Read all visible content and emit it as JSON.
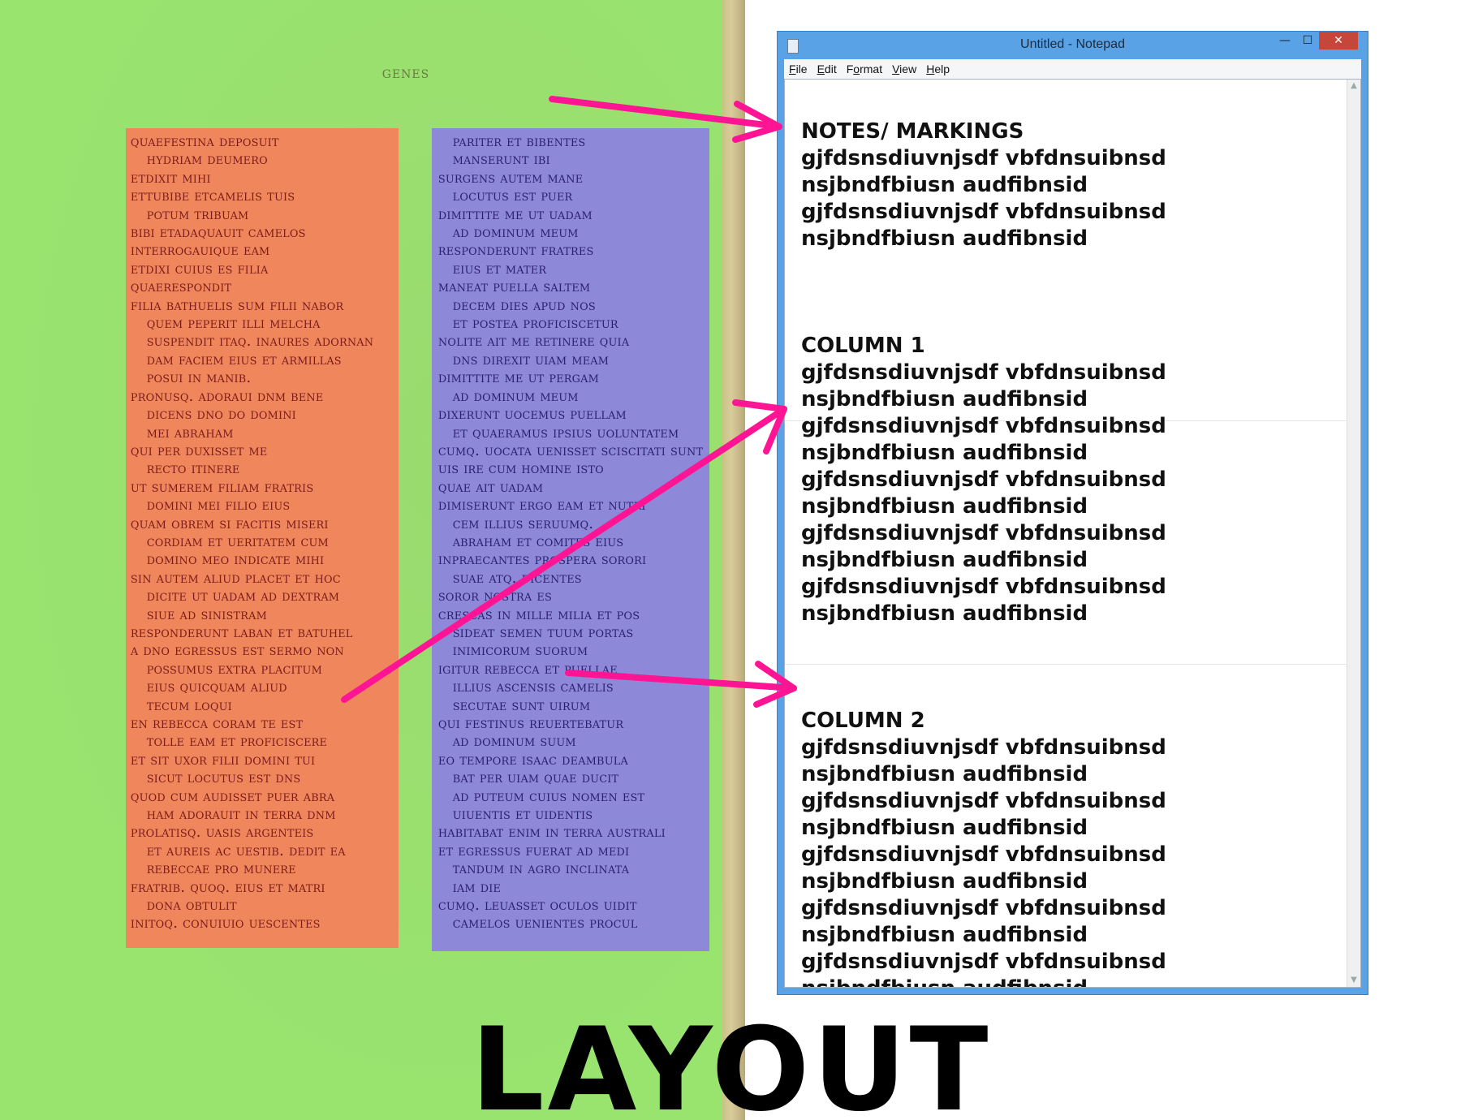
{
  "colors": {
    "page_background": "#98e46f",
    "column_1_highlight": "#f0875c",
    "column_2_highlight": "#8d88d8",
    "arrow": "#ff1493",
    "notepad_frame": "#5aa2e6",
    "close_button": "#c7463a"
  },
  "manuscript": {
    "running_head": "GENES",
    "column_1": [
      "quaefestina deposuit",
      "hydriam deumero",
      "etdixit mihi",
      "ettubibe etcamelis tuis",
      "potum tribuam",
      "bibi etadaquauit camelos",
      "interrogauique eam",
      "etdixi cuius es filia",
      "quaerespondit",
      "filia bathuelis sum filii nabor",
      "quem peperit illi melcha",
      "suspendit itaq. inaures adornan",
      "dam faciem eius et armillas",
      "posui in manib.",
      "pronusq. adoraui dnm bene",
      "dicens dno do domini",
      "mei abraham",
      "qui per duxisset me",
      "recto itinere",
      "ut sumerem filiam fratris",
      "domini mei filio eius",
      "quam obrem si facitis miseri",
      "cordiam et ueritatem cum",
      "domino meo indicate mihi",
      "sin autem aliud placet et hoc",
      "dicite ut uadam ad dextram",
      "siue ad sinistram",
      "responderunt laban et batuhel",
      "a dno egressus est sermo non",
      "possumus extra placitum",
      "eius quicquam aliud",
      "tecum loqui",
      "en rebecca coram te est",
      "tolle eam et proficiscere",
      "et sit uxor filii domini tui",
      "sicut locutus est dns",
      "quod cum audisset puer abra",
      "ham adorauit in terra dnm",
      "prolatisq. uasis argenteis",
      "et aureis ac uestib. dedit ea",
      "rebeccae pro munere",
      "fratrib. quoq. eius et matri",
      "dona obtulit",
      "initoq. conuiuio uescentes"
    ],
    "column_2": [
      "pariter et bibentes",
      "manserunt ibi",
      "surgens autem mane",
      "locutus est puer",
      "dimittite me ut uadam",
      "ad dominum meum",
      "responderunt fratres",
      "eius et mater",
      "maneat puella saltem",
      "decem dies apud nos",
      "et postea proficiscetur",
      "nolite ait me retinere quia",
      "dns direxit uiam meam",
      "dimittite me ut pergam",
      "ad dominum meum",
      "dixerunt uocemus puellam",
      "et quaeramus ipsius uoluntatem",
      "cumq. uocata uenisset sciscitati sunt",
      "uis ire cum homine isto",
      "quae ait uadam",
      "dimiserunt ergo eam et nutri",
      "cem illius seruumq.",
      "abraham et comites eius",
      "inpraecantes prospera sorori",
      "suae atq. dicentes",
      "soror nostra es",
      "crescas in mille milia et pos",
      "sideat semen tuum portas",
      "inimicorum suorum",
      "igitur rebecca et puellae",
      "illius ascensis camelis",
      "secutae sunt uirum",
      "qui festinus reuertebatur",
      "ad dominum suum",
      "eo tempore isaac deambula",
      "bat per uiam quae ducit",
      "ad puteum cuius nomen est",
      "uiuentis et uidentis",
      "habitabat enim in terra australi",
      "et egressus fuerat ad medi",
      "tandum in agro inclinata",
      "iam die",
      "cumq. leuasset oculos uidit",
      "camelos uenientes procul"
    ]
  },
  "notepad": {
    "title": "Untitled - Notepad",
    "menu": [
      {
        "hotkey": "F",
        "rest": "ile"
      },
      {
        "hotkey": "E",
        "rest": "dit"
      },
      {
        "hotkey": "o",
        "pre": "F",
        "rest": "rmat"
      },
      {
        "hotkey": "V",
        "rest": "iew"
      },
      {
        "hotkey": "H",
        "rest": "elp"
      }
    ],
    "controls": {
      "minimize": "—",
      "maximize": "☐",
      "close": "✕"
    },
    "sections": [
      {
        "heading": "NOTES/ MARKINGS",
        "lines": [
          "gjfdsnsdiuvnjsdf vbfdnsuibnsd",
          "nsjbndfbiusn audfibnsid",
          "gjfdsnsdiuvnjsdf vbfdnsuibnsd",
          "nsjbndfbiusn audfibnsid"
        ]
      },
      {
        "heading": "COLUMN 1",
        "lines": [
          "gjfdsnsdiuvnjsdf vbfdnsuibnsd",
          "nsjbndfbiusn audfibnsid",
          "gjfdsnsdiuvnjsdf vbfdnsuibnsd",
          "nsjbndfbiusn audfibnsid",
          "gjfdsnsdiuvnjsdf vbfdnsuibnsd",
          "nsjbndfbiusn audfibnsid",
          "gjfdsnsdiuvnjsdf vbfdnsuibnsd",
          "nsjbndfbiusn audfibnsid",
          "gjfdsnsdiuvnjsdf vbfdnsuibnsd",
          "nsjbndfbiusn audfibnsid"
        ]
      },
      {
        "heading": "COLUMN 2",
        "lines": [
          "gjfdsnsdiuvnjsdf vbfdnsuibnsd",
          "nsjbndfbiusn audfibnsid",
          "gjfdsnsdiuvnjsdf vbfdnsuibnsd",
          "nsjbndfbiusn audfibnsid",
          "gjfdsnsdiuvnjsdf vbfdnsuibnsd",
          "nsjbndfbiusn audfibnsid",
          "gjfdsnsdiuvnjsdf vbfdnsuibnsd",
          "nsjbndfbiusn audfibnsid",
          "gjfdsnsdiuvnjsdf vbfdnsuibnsd",
          "nsjbndfbiusn audfibnsid"
        ]
      }
    ]
  },
  "caption": "LAYOUT"
}
